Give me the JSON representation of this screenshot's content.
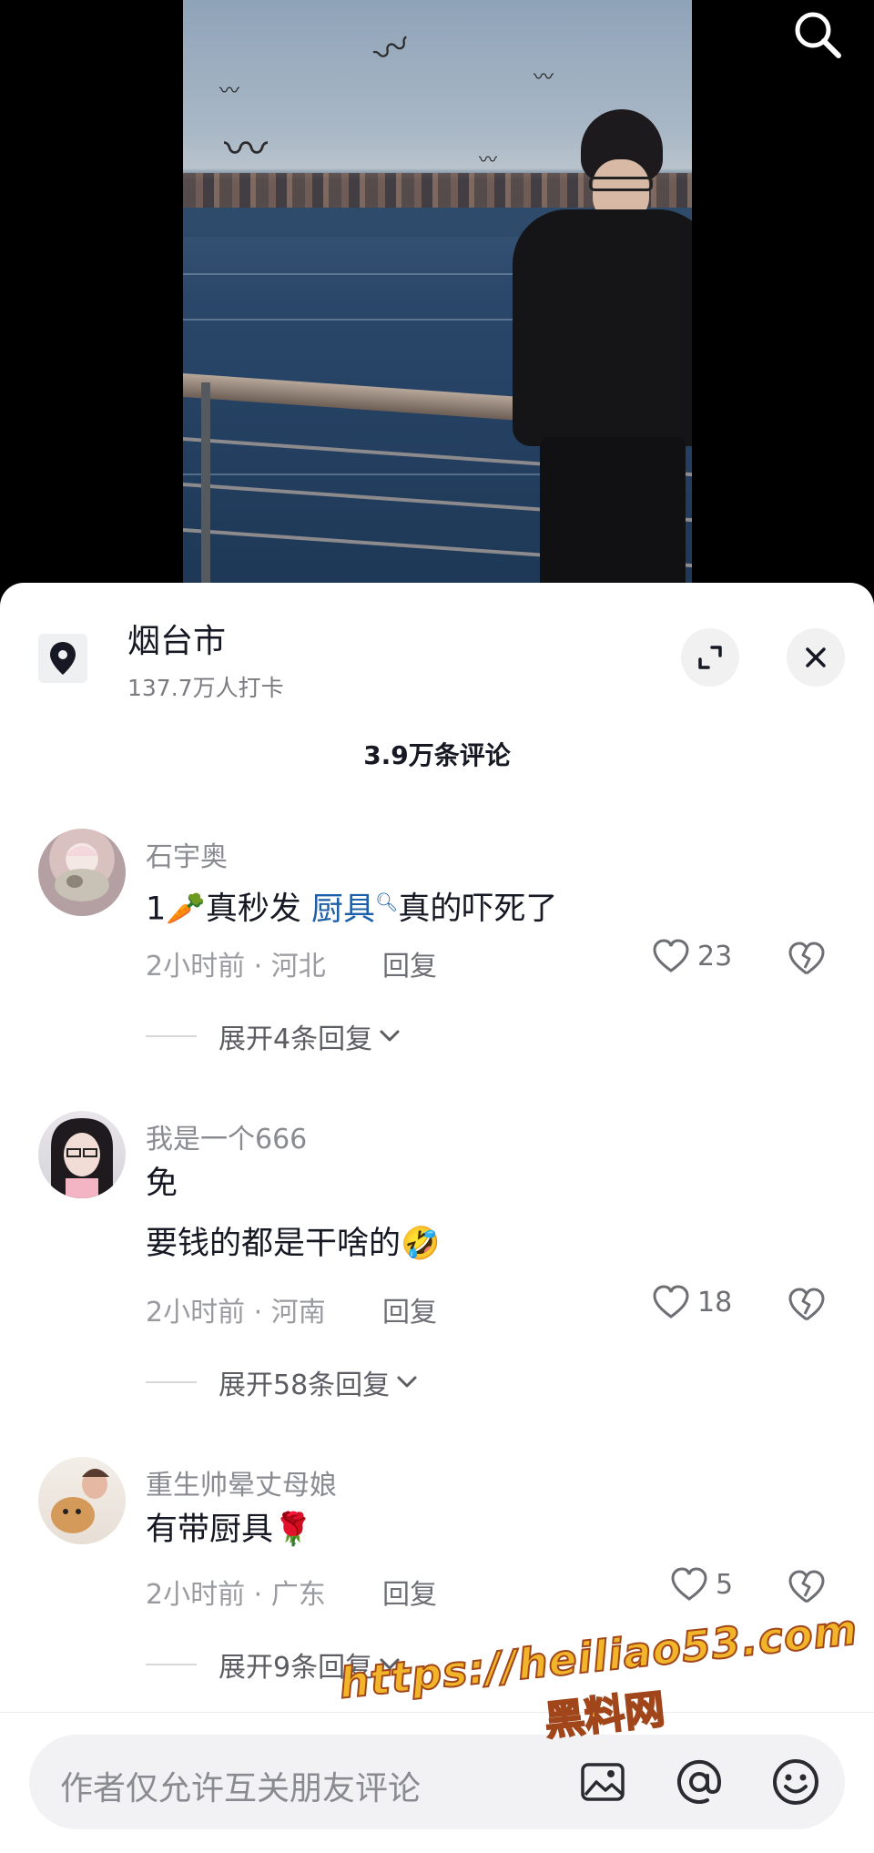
{
  "location": {
    "title": "烟台市",
    "subtitle": "137.7万人打卡"
  },
  "comment_count": "3.9万条评论",
  "comments": [
    {
      "user": "石宇奥",
      "text_pre": "1🥕真秒发 ",
      "text_link": "厨具",
      "text_post": "真的吓死了",
      "meta": "2小时前 · 河北",
      "reply_label": "回复",
      "likes": "23",
      "expand": "展开4条回复"
    },
    {
      "user": "我是一个666",
      "text_line1": "免",
      "text_line2": "要钱的都是干啥的🤣",
      "meta": "2小时前 · 河南",
      "reply_label": "回复",
      "likes": "18",
      "expand": "展开58条回复"
    },
    {
      "user": "重生帅晕丈母娘",
      "text": "有带厨具🌹",
      "meta": "2小时前 · 广东",
      "reply_label": "回复",
      "likes": "5",
      "expand": "展开9条回复"
    }
  ],
  "input": {
    "placeholder": "作者仅允许互关朋友评论"
  },
  "watermark": {
    "url": "https://heiliao53.com",
    "name": "黑料网"
  },
  "icons": {
    "search": "search-icon",
    "location": "location-pin-icon",
    "expand": "expand-icon",
    "close": "close-icon",
    "like": "heart-icon",
    "dislike": "broken-heart-icon",
    "chevron": "chevron-down-icon",
    "image": "image-icon",
    "at": "at-icon",
    "emoji": "emoji-icon"
  },
  "colors": {
    "link": "#1d5fa8",
    "watermark": "#f2b52a",
    "sheet": "#ffffff"
  }
}
